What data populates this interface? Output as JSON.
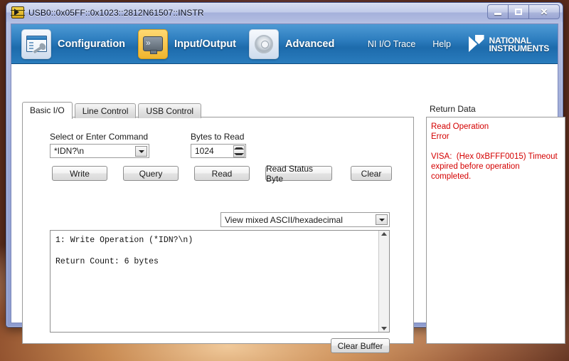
{
  "window": {
    "title": "USB0::0x05FF::0x1023::2812N61507::INSTR",
    "app_icon": "ni-visa-icon",
    "controls": {
      "minimize": "minimize-icon",
      "maximize": "maximize-icon",
      "close": "close-icon"
    }
  },
  "toolbar": {
    "items": [
      {
        "label": "Configuration",
        "icon": "configuration-window-wrench-icon",
        "active": false
      },
      {
        "label": "Input/Output",
        "icon": "monitor-console-icon",
        "active": true
      },
      {
        "label": "Advanced",
        "icon": "gear-icon",
        "active": false
      }
    ],
    "links": [
      {
        "label": "NI I/O Trace"
      },
      {
        "label": "Help"
      }
    ],
    "logo": {
      "line1": "NATIONAL",
      "line2": "INSTRUMENTS",
      "mark": "ni-eagle-logo-icon"
    }
  },
  "tabs": [
    {
      "label": "Basic I/O",
      "selected": true
    },
    {
      "label": "Line Control",
      "selected": false
    },
    {
      "label": "USB Control",
      "selected": false
    }
  ],
  "form": {
    "command": {
      "label": "Select or Enter Command",
      "value": "*IDN?\\n",
      "dropdown_icon": "chevron-down-icon"
    },
    "bytes": {
      "label": "Bytes to Read",
      "value": "1024",
      "spinner_up_icon": "caret-up-icon",
      "spinner_down_icon": "caret-down-icon"
    },
    "buttons": [
      {
        "label": "Write"
      },
      {
        "label": "Query"
      },
      {
        "label": "Read"
      },
      {
        "label": "Read Status Byte"
      },
      {
        "label": "Clear"
      }
    ],
    "view_mode": {
      "value": "View mixed ASCII/hexadecimal",
      "dropdown_icon": "chevron-down-icon"
    },
    "clear_buffer_label": "Clear Buffer"
  },
  "output": {
    "text": "1: Write Operation (*IDN?\\n)\n\nReturn Count: 6 bytes",
    "scroll_up_icon": "scroll-up-arrow-icon",
    "scroll_down_icon": "scroll-down-arrow-icon"
  },
  "return_data": {
    "title": "Return Data",
    "text": "Read Operation\nError\n\nVISA:  (Hex 0xBFFF0015) Timeout\nexpired before operation completed.",
    "color": "#d40000"
  },
  "colors": {
    "toolbar_blue": "#2f7fc0",
    "active_icon_amber": "#f0b52e",
    "error_red": "#d40000",
    "window_chrome": "#9aa7d6"
  }
}
